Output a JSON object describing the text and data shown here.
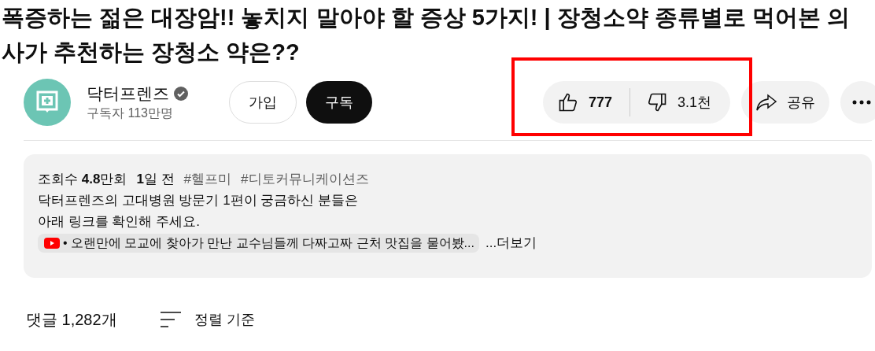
{
  "video_title": "폭증하는 젊은 대장암!! 놓치지 말아야 할 증상 5가지! | 장청소약 종류별로 먹어본 의사가 추천하는 장청소 약은??",
  "channel": {
    "name": "닥터프렌즈",
    "verified": true,
    "subscribers": "구독자 113만명"
  },
  "join_button": "가입",
  "subscribe_button": {
    "label": "구독",
    "subscribed": false
  },
  "reactions": {
    "highlighted": true,
    "likes": "777",
    "dislikes": "3.1천"
  },
  "share_button": "공유",
  "description": {
    "views": "조회수 **4.8**만회",
    "date": "**1**일 전",
    "hashtags": [
      "#헬프미",
      "#디토커뮤니케이션즈"
    ],
    "lines": [
      "닥터프렌즈의 고대병원 방문기 1편이 궁금하신 분들은",
      "아래 링크를 확인해 주세요."
    ],
    "link": "• 오랜만에 모교에 찾아가 만난 교수님들께 다짜고짜 근처 맛집을 물어봤...",
    "more": "...더보기"
  },
  "comments": {
    "count": "댓글 1,282개",
    "sort": "정렬 기준"
  }
}
